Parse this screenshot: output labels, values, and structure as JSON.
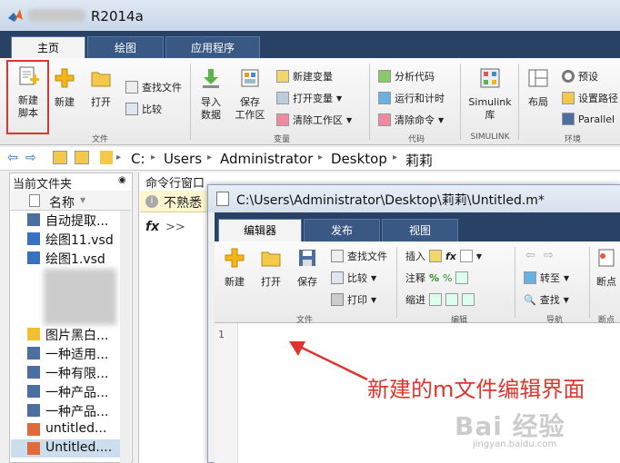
{
  "window": {
    "title": "R2014a"
  },
  "main_tabs": [
    "主页",
    "绘图",
    "应用程序"
  ],
  "ribbon": {
    "new_script": "新建\n脚本",
    "new_script_l1": "新建",
    "new_script_l2": "脚本",
    "new": "新建",
    "open": "打开",
    "find_files": "查找文件",
    "compare": "比较",
    "import_l1": "导入",
    "import_l2": "数据",
    "save_ws_l1": "保存",
    "save_ws_l2": "工作区",
    "new_var": "新建变量",
    "open_var": "打开变量",
    "clear_ws": "清除工作区",
    "analyze_code": "分析代码",
    "run_time": "运行和计时",
    "clear_cmds": "清除命令",
    "simulink_l1": "Simulink",
    "simulink_l2": "库",
    "layout": "布局",
    "prefs": "预设",
    "set_path": "设置路径",
    "parallel": "Parallel",
    "groups": [
      "文件",
      "变量",
      "代码",
      "SIMULINK",
      "环境"
    ]
  },
  "address": {
    "parts": [
      "C:",
      "Users",
      "Administrator",
      "Desktop",
      "莉莉"
    ],
    "sep": "▸"
  },
  "current_folder": {
    "title": "当前文件夹",
    "column": "名称",
    "files": [
      "自动提取...",
      "绘图11.vsd",
      "绘图1.vsd",
      "",
      "",
      "",
      "图片黑白...",
      "一种适用...",
      "一种有限...",
      "一种产品...",
      "一种产品...",
      "untitled...",
      "Untitled...."
    ]
  },
  "command_window": {
    "title": "命令行窗口",
    "notice": "不熟悉",
    "prompt": ">>",
    "fx": "fx"
  },
  "editor": {
    "title": "C:\\Users\\Administrator\\Desktop\\莉莉\\Untitled.m*",
    "tabs": [
      "编辑器",
      "发布",
      "视图"
    ],
    "new": "新建",
    "open": "打开",
    "save": "保存",
    "find_files": "查找文件",
    "compare": "比较",
    "print": "打印",
    "insert": "插入",
    "comment": "注释",
    "indent": "缩进",
    "goto": "转至",
    "find": "查找",
    "breakpoint": "断点",
    "groups": [
      "文件",
      "编辑",
      "导航",
      "断点"
    ],
    "line": "1"
  },
  "annotation": "新建的m文件编辑界面",
  "watermark": {
    "brand": "Bai 经验",
    "url": "jingyan.baidu.com"
  },
  "colors": {
    "accent_red": "#e0352f",
    "ribbon_blue": "#2a4166"
  }
}
